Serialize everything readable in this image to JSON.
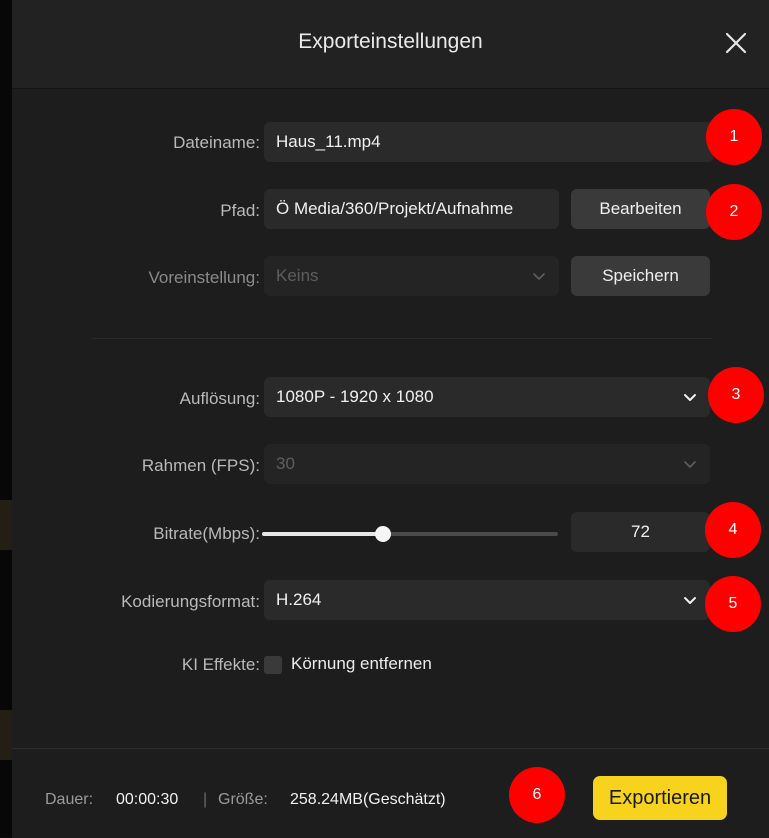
{
  "dialog": {
    "title": "Exporteinstellungen"
  },
  "form": {
    "filename_label": "Dateiname:",
    "filename_value": "Haus_11.mp4",
    "path_label": "Pfad:",
    "path_value": "Ö Media/360/Projekt/Aufnahme",
    "edit_button": "Bearbeiten",
    "preset_label": "Voreinstellung:",
    "preset_value": "Keins",
    "save_button": "Speichern",
    "resolution_label": "Auflösung:",
    "resolution_value": "1080P - 1920 x 1080",
    "fps_label": "Rahmen (FPS):",
    "fps_value": "30",
    "bitrate_label": "Bitrate(Mbps):",
    "bitrate_value": "72",
    "bitrate_slider_fraction": 0.41,
    "codec_label": "Kodierungsformat:",
    "codec_value": "H.264",
    "ai_effects_label": "KI Effekte:",
    "ai_effects_option": "Körnung entfernen",
    "ai_effects_checked": false
  },
  "footer": {
    "duration_label": "Dauer:",
    "duration_value": "00:00:30",
    "separator": "|",
    "size_label": "Größe:",
    "size_value": "258.24MB(Geschätzt)",
    "export_button": "Exportieren"
  },
  "annotations": [
    "1",
    "2",
    "3",
    "4",
    "5",
    "6"
  ],
  "colors": {
    "accent": "#f8d31d",
    "marker": "#ff0000",
    "background": "#1d1d1e"
  },
  "icons": {
    "close": "close-icon",
    "dropdown": "chevron-down-icon"
  }
}
